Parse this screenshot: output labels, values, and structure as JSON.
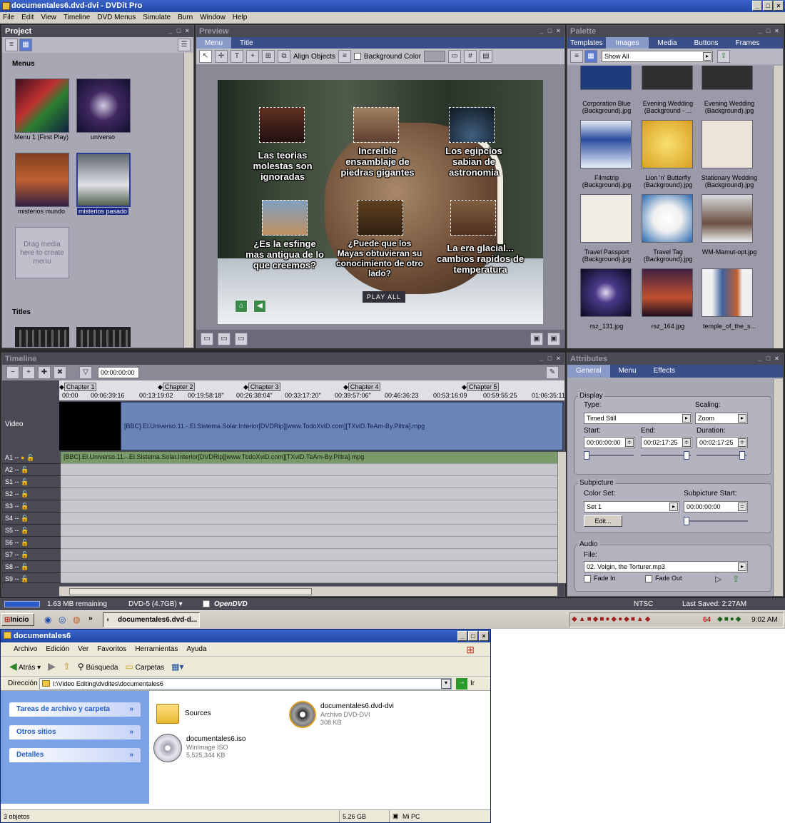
{
  "window": {
    "title": "documentales6.dvd-dvi - DVDit Pro"
  },
  "menubar": [
    "File",
    "Edit",
    "View",
    "Timeline",
    "DVD Menus",
    "Simulate",
    "Burn",
    "Window",
    "Help"
  ],
  "project": {
    "title": "Project",
    "section_menus": "Menus",
    "section_titles": "Titles",
    "menus": [
      {
        "label": "Menu 1 (First Play)"
      },
      {
        "label": "universo"
      },
      {
        "label": "misterios mundo"
      },
      {
        "label": "misterios pasado"
      }
    ],
    "drop_hint": "Drag media here to create menu"
  },
  "preview": {
    "title": "Preview",
    "tabs": [
      "Menu",
      "Title"
    ],
    "align_label": "Align Objects",
    "bg_label": "Background Color",
    "items": [
      "Las teorias molestas son ignoradas",
      "Increible ensamblaje de piedras gigantes",
      "Los egipcios sabian de astronomia",
      "¿Es la esfinge mas antigua de lo que creemos?",
      "¿Puede que los Mayas obtuvieran su conocimiento de otro lado?",
      "La era glacial... cambios rapidos de temperatura"
    ],
    "play_all": "PLAY ALL"
  },
  "palette": {
    "title": "Palette",
    "tabs": [
      "Templates",
      "Images",
      "Media",
      "Buttons",
      "Frames"
    ],
    "filter": "Show All",
    "items": [
      [
        "Corporation Blue (Background).jpg",
        "Evening Wedding (Background - ...",
        "Evening Wedding (Background).jpg"
      ],
      [
        "Filmstrip (Background).jpg",
        "Lion 'n' Butterfly (Background).jpg",
        "Stationary Wedding (Background).jpg"
      ],
      [
        "Travel Passport (Background).jpg",
        "Travel Tag (Background).jpg",
        "WM-Mamut-opt.jpg"
      ],
      [
        "rsz_131.jpg",
        "rsz_164.jpg",
        "temple_of_the_s..."
      ]
    ]
  },
  "timeline": {
    "title": "Timeline",
    "timecode": "00:00:00:00",
    "chapters": [
      "Chapter 1",
      "Chapter 2",
      "Chapter 3",
      "Chapter 4",
      "Chapter 5"
    ],
    "ruler": [
      "00:00",
      "00:06:39:16",
      "00:13:19:02",
      "00:19:58:18\"",
      "00:26:38:04\"",
      "00:33:17:20\"",
      "00:39:57:06\"",
      "00:46:36:23",
      "00:53:16:09",
      "00:59:55:25",
      "01:06:35:11"
    ],
    "video_label": "Video",
    "video_clip": "[BBC].El.Universo.11.-.El.Sistema.Solar.Interior[DVDRip][www.TodoXviD.com][TXviD.TeAm-By.Piltra].mpg",
    "audio_clip": "[BBC].El.Universo.11.-.El.Sistema.Solar.Interior[DVDRip][www.TodoXviD.com][TXviD.TeAm-By.Piltra].mpg",
    "tracks": [
      "A1",
      "A2",
      "S1",
      "S2",
      "S3",
      "S4",
      "S5",
      "S6",
      "S7",
      "S8",
      "S9"
    ],
    "track_dash": "--"
  },
  "attributes": {
    "title": "Attributes",
    "tabs": [
      "General",
      "Menu",
      "Effects"
    ],
    "display": {
      "title": "Display",
      "type_label": "Type:",
      "type": "Timed Still",
      "scaling_label": "Scaling:",
      "scaling": "Zoom",
      "start_label": "Start:",
      "start": "00:00:00:00",
      "end_label": "End:",
      "end": "00:02:17:25",
      "duration_label": "Duration:",
      "duration": "00:02:17:25"
    },
    "subpicture": {
      "title": "Subpicture",
      "colorset_label": "Color Set:",
      "colorset": "Set 1",
      "substart_label": "Subpicture Start:",
      "substart": "00:00:00:00",
      "edit": "Edit..."
    },
    "audio": {
      "title": "Audio",
      "file_label": "File:",
      "file": "02. Volgin, the Torturer.mp3",
      "fadein": "Fade In",
      "fadeout": "Fade Out"
    }
  },
  "status": {
    "remaining": "1.63 MB remaining",
    "disc": "DVD-5 (4.7GB)",
    "opendvd": "OpenDVD",
    "standard": "NTSC",
    "saved": "Last Saved: 2:27AM"
  },
  "taskbar": {
    "start": "Inicio",
    "task": "documentales6.dvd-d...",
    "clock": "9:02 AM",
    "tray_num": "64"
  },
  "explorer": {
    "title": "documentales6",
    "menu": [
      "Archivo",
      "Edición",
      "Ver",
      "Favoritos",
      "Herramientas",
      "Ayuda"
    ],
    "back": "Atrás",
    "search": "Búsqueda",
    "folders": "Carpetas",
    "address_label": "Dirección",
    "address": "I:\\Video Editing\\dvdites\\documentales6",
    "go": "Ir",
    "sidebar": [
      "Tareas de archivo y carpeta",
      "Otros sitios",
      "Detalles"
    ],
    "files": [
      {
        "name": "Sources"
      },
      {
        "name": "documentales6.dvd-dvi",
        "type": "Archivo DVD-DVI",
        "size": "308 KB"
      },
      {
        "name": "documentales6.iso",
        "type": "WinImage ISO",
        "size": "5,525,344 KB"
      }
    ],
    "status": {
      "count": "3 objetos",
      "size": "5.26 GB",
      "location": "Mi PC"
    }
  }
}
